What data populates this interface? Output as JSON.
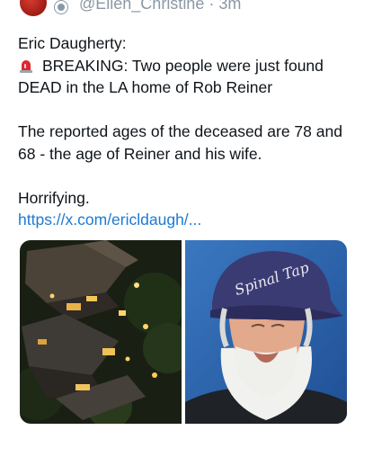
{
  "tweet": {
    "handle": "@Ellen_Christine · 3m",
    "author_line": "Eric Daugherty:",
    "emoji": "rotating-light-emoji",
    "line1": "BREAKING: Two people were just found DEAD in the LA home of Rob Reiner",
    "line2": "The reported ages of the deceased are 78 and 68 - the age of Reiner and his wife.",
    "line3": "Horrifying.",
    "link": "https://x.com/ericldaugh/..."
  },
  "media": {
    "left_image": "aerial-night-house-photo",
    "right_image": "bearded-man-in-cap-photo",
    "cap_text": "Spinal Tap"
  },
  "colors": {
    "text": "#0f1419",
    "secondary": "#8b98a5",
    "link": "#1d7ad2"
  }
}
